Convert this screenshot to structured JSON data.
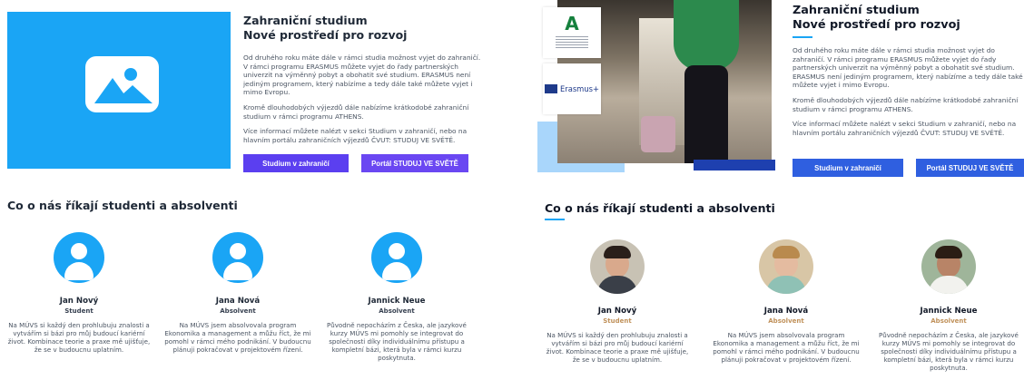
{
  "left": {
    "heading_line1": "Zahraniční studium",
    "heading_line2": "Nové prostředí pro rozvoj",
    "paragraphs": [
      "Od druhého roku máte dále v rámci studia možnost vyjet do zahraničí. V rámci programu ERASMUS můžete vyjet do řady partnerských univerzit na výměnný pobyt a obohatit své studium. ERASMUS není jediným programem, který nabízíme a tedy dále také můžete vyjet i mimo Evropu.",
      "Kromě dlouhodobých výjezdů dále nabízíme krátkodobé zahraniční studium v rámci programu ATHENS.",
      "Více informací můžete nalézt v sekci Studium v zahraničí, nebo na hlavním portálu zahraničních výjezdů ČVUT: STUDUJ VE SVĚTĚ."
    ],
    "buttons": {
      "primary": "Studium v zahraničí",
      "secondary": "Portál STUDUJ VE SVĚTĚ"
    },
    "section_title": "Co o nás říkají studenti a absolventi",
    "testimonials": [
      {
        "name": "Jan Nový",
        "role": "Student",
        "quote": "Na MÚVS si každý den prohlubuju znalosti a vytvářím si bázi pro můj budoucí kariérní život. Kombinace teorie a praxe mě ujišťuje, že se v budoucnu uplatním."
      },
      {
        "name": "Jana Nová",
        "role": "Absolvent",
        "quote": "Na MÚVS jsem absolvovala program Ekonomika a management a můžu říct, že mi pomohl v rámci mého podnikání. V budoucnu plánuji pokračovat v projektovém řízení."
      },
      {
        "name": "Jannick Neue",
        "role": "Absolvent",
        "quote": "Původně nepocházím z Česka, ale jazykové kurzy MÚVS mi pomohly se integrovat do společnosti díky individuálnímu přístupu a kompletní bázi, která byla v rámci kurzu poskytnuta."
      }
    ]
  },
  "right": {
    "heading_line1": "Zahraniční studium",
    "heading_line2": "Nové prostředí pro rozvoj",
    "logo_erasmus": "Erasmus+",
    "paragraphs": [
      "Od druhého roku máte dále v rámci studia možnost vyjet do zahraničí. V rámci programu ERASMUS můžete vyjet do řady partnerských univerzit na výměnný pobyt a obohatit své studium. ERASMUS není jediným programem, který nabízíme a tedy dále také můžete vyjet i mimo Evropu.",
      "Kromě dlouhodobých výjezdů dále nabízíme krátkodobé zahraniční studium v rámci programu ATHENS.",
      "Více informací můžete nalézt v sekci Studium v zahraničí, nebo na hlavním portálu zahraničních výjezdů ČVUT: STUDUJ VE SVĚTĚ."
    ],
    "buttons": {
      "primary": "Studium v zahraničí",
      "secondary": "Portál STUDUJ VE SVĚTĚ"
    },
    "section_title": "Co o nás říkají studenti a absolventi",
    "testimonials": [
      {
        "name": "Jan Nový",
        "role": "Student",
        "quote": "Na MÚVS si každý den prohlubuju znalosti a vytvářím si bázi pro můj budoucí kariérní život. Kombinace teorie a praxe mě ujišťuje, že se v budoucnu uplatním."
      },
      {
        "name": "Jana Nová",
        "role": "Absolvent",
        "quote": "Na MÚVS jsem absolvovala program Ekonomika a management a můžu říct, že mi pomohl v rámci mého podnikání. V budoucnu plánuji pokračovat v projektovém řízení."
      },
      {
        "name": "Jannick Neue",
        "role": "Absolvent",
        "quote": "Původně nepocházím z Česka, ale jazykové kurzy MÚVS mi pomohly se integrovat do společnosti díky individuálnímu přístupu a kompletní bázi, která byla v rámci kurzu poskytnuta."
      }
    ]
  },
  "colors": {
    "placeholder_blue": "#1aa5f5",
    "wireframe_button": "#5b3ff0",
    "final_button": "#2f5fe0",
    "role_accent": "#c0915a"
  }
}
